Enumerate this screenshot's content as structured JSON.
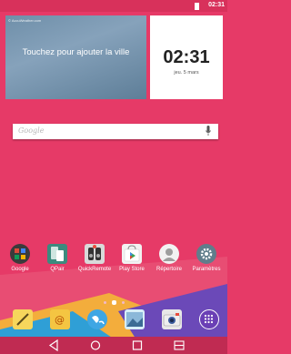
{
  "status": {
    "time": "02:31"
  },
  "weather": {
    "credit": "© AccuWeather.com",
    "cta": "Touchez pour ajouter la ville"
  },
  "clock": {
    "time": "02:31",
    "date": "jeu. 5 mars"
  },
  "search": {
    "label": "Google"
  },
  "apps": [
    {
      "label": "Google",
      "icon": "google-folder-icon"
    },
    {
      "label": "QPair",
      "icon": "qpair-icon"
    },
    {
      "label": "QuickRemote",
      "icon": "quickremote-icon"
    },
    {
      "label": "Play Store",
      "icon": "play-store-icon"
    },
    {
      "label": "Répertoire",
      "icon": "contacts-icon"
    },
    {
      "label": "Paramètres",
      "icon": "settings-icon"
    }
  ],
  "dock": [
    {
      "icon": "memo-icon"
    },
    {
      "icon": "email-icon"
    },
    {
      "icon": "internet-globe-icon"
    },
    {
      "icon": "gallery-icon"
    },
    {
      "icon": "camera-icon"
    },
    {
      "icon": "apps-drawer-icon"
    }
  ],
  "colors": {
    "background": "#e63a67",
    "navbar": "#c02b52"
  }
}
